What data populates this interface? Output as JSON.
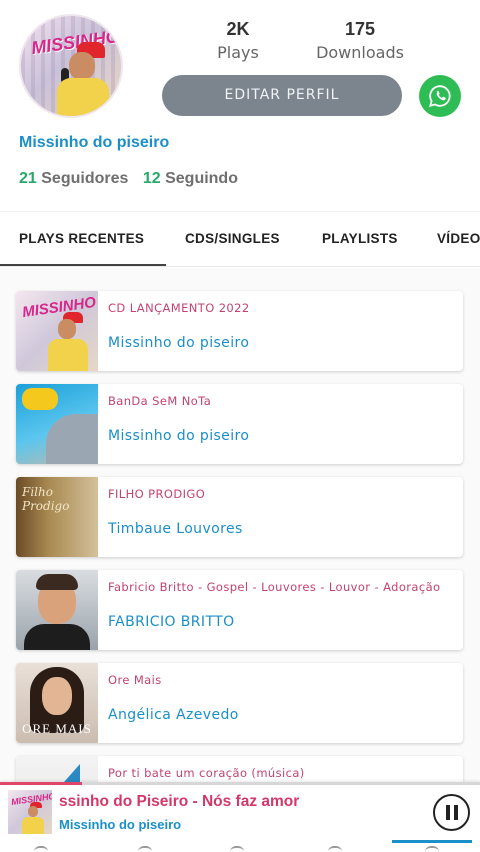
{
  "profile": {
    "plays_count": "2K",
    "plays_label": "Plays",
    "downloads_count": "175",
    "downloads_label": "Downloads",
    "edit_button": "EDITAR PERFIL",
    "name": "Missinho do piseiro",
    "followers_count": "21",
    "followers_label": "Seguidores",
    "following_count": "12",
    "following_label": "Seguindo",
    "avatar_logo": "MISSINHO"
  },
  "tabs": [
    {
      "label": "PLAYS RECENTES",
      "active": true
    },
    {
      "label": "CDS/SINGLES",
      "active": false
    },
    {
      "label": "PLAYLISTS",
      "active": false
    },
    {
      "label": "VÍDEOS",
      "active": false
    }
  ],
  "recent_plays": [
    {
      "subtitle": "CD LANÇAMENTO 2022",
      "artist": "Missinho do piseiro",
      "thumb_text": "MISSINHO"
    },
    {
      "subtitle": "BanDa SeM NoTa",
      "artist": "Missinho do piseiro",
      "thumb_text": ""
    },
    {
      "subtitle": "FILHO PRODIGO",
      "artist": "Timbaue Louvores",
      "thumb_text": "Filho Prodigo"
    },
    {
      "subtitle": "Fabricio Britto - Gospel - Louvores - Louvor - Adoração",
      "artist": "FABRICIO BRITTO",
      "thumb_text": ""
    },
    {
      "subtitle": "Ore Mais",
      "artist": "Angélica Azevedo",
      "thumb_text": "ORE MAIS"
    },
    {
      "subtitle": "Por ti bate um coração (música)",
      "artist": "",
      "thumb_text": ""
    }
  ],
  "player": {
    "title": "ssinho do Piseiro - Nós faz amor",
    "artist": "Missinho do piseiro",
    "progress": 0.17
  },
  "colors": {
    "accent_blue": "#1b8fc7",
    "accent_pink": "#c2436f",
    "follow_green": "#29a86b",
    "whatsapp_green": "#2ebd55",
    "edit_button_gray": "#7c848d"
  },
  "icons": {
    "whatsapp": "whatsapp-icon",
    "pause": "pause-icon"
  }
}
